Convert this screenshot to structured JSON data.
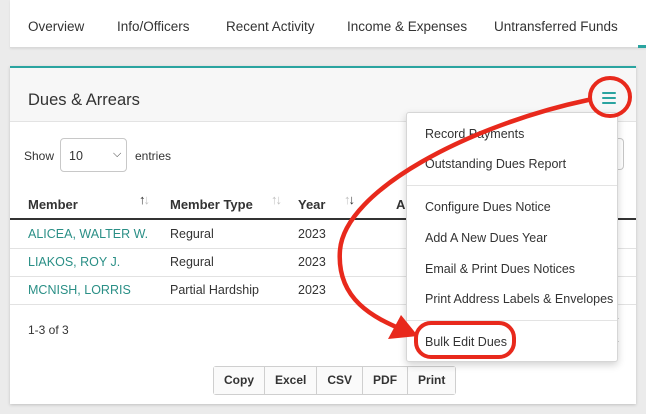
{
  "tabs": [
    "Overview",
    "Info/Officers",
    "Recent Activity",
    "Income & Expenses",
    "Untransferred Funds"
  ],
  "panel": {
    "title": "Dues & Arrears",
    "show_label": "Show",
    "page_length": "10",
    "entries_label": "entries"
  },
  "table": {
    "columns": [
      "Member",
      "Member Type",
      "Year",
      "A"
    ],
    "rows": [
      {
        "member": "ALICEA, WALTER W.",
        "type": "Regural",
        "year": "2023"
      },
      {
        "member": "LIAKOS, ROY J.",
        "type": "Regural",
        "year": "2023"
      },
      {
        "member": "MCNISH, LORRIS",
        "type": "Partial Hardship",
        "year": "2023"
      }
    ],
    "count": "1-3 of 3"
  },
  "export_buttons": [
    "Copy",
    "Excel",
    "CSV",
    "PDF",
    "Print"
  ],
  "menu": {
    "items": [
      "Record Payments",
      "Outstanding Dues Report",
      "Configure Dues Notice",
      "Add A New Dues Year",
      "Email & Print Dues Notices",
      "Print Address Labels & Envelopes",
      "Bulk Edit Dues"
    ]
  },
  "colors": {
    "accent": "#2aa4a0",
    "link": "#2a8f86",
    "annotation": "#e8291c"
  },
  "icons": {
    "menu": "hamburger-icon",
    "select_caret": "chevron-down-icon",
    "sort": "sort-arrows-icon"
  }
}
